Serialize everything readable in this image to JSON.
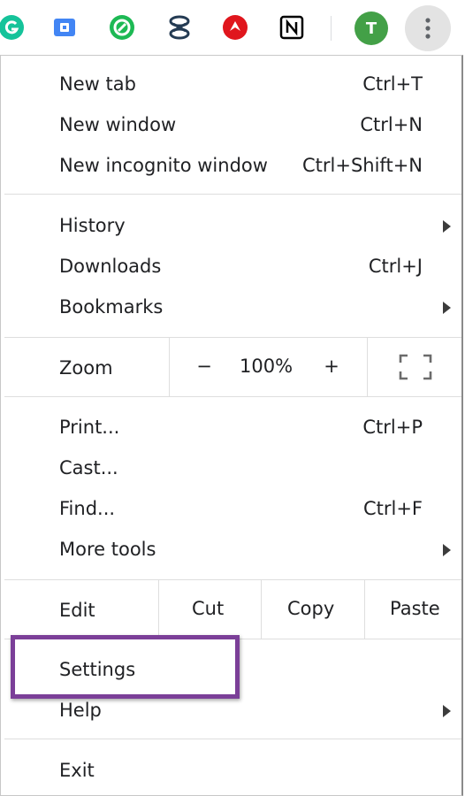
{
  "toolbar": {
    "avatar_letter": "T",
    "extensions": [
      {
        "icon": "grammarly-icon",
        "color": "#15c39a"
      },
      {
        "icon": "extension-blue-icon",
        "color": "#4285f4"
      },
      {
        "icon": "leaf-extension-icon",
        "color": "#1db954"
      },
      {
        "icon": "hourglass-extension-icon",
        "color": "#243b53"
      },
      {
        "icon": "red-extension-icon",
        "color": "#e0161d"
      },
      {
        "icon": "notion-icon",
        "color": "#000000"
      }
    ],
    "avatar_color": "#43a047",
    "kebab_bg": "#e3e3e3"
  },
  "menu": {
    "new_tab": {
      "label": "New tab",
      "shortcut": "Ctrl+T"
    },
    "new_window": {
      "label": "New window",
      "shortcut": "Ctrl+N"
    },
    "new_incognito": {
      "label": "New incognito window",
      "shortcut": "Ctrl+Shift+N"
    },
    "history": {
      "label": "History"
    },
    "downloads": {
      "label": "Downloads",
      "shortcut": "Ctrl+J"
    },
    "bookmarks": {
      "label": "Bookmarks"
    },
    "zoom": {
      "label": "Zoom",
      "minus": "−",
      "level": "100%",
      "plus": "+"
    },
    "print": {
      "label": "Print...",
      "shortcut": "Ctrl+P"
    },
    "cast": {
      "label": "Cast..."
    },
    "find": {
      "label": "Find...",
      "shortcut": "Ctrl+F"
    },
    "more_tools": {
      "label": "More tools"
    },
    "edit": {
      "label": "Edit",
      "cut": "Cut",
      "copy": "Copy",
      "paste": "Paste"
    },
    "settings": {
      "label": "Settings"
    },
    "help": {
      "label": "Help"
    },
    "exit": {
      "label": "Exit"
    }
  },
  "highlight_color": "#7b3f98"
}
